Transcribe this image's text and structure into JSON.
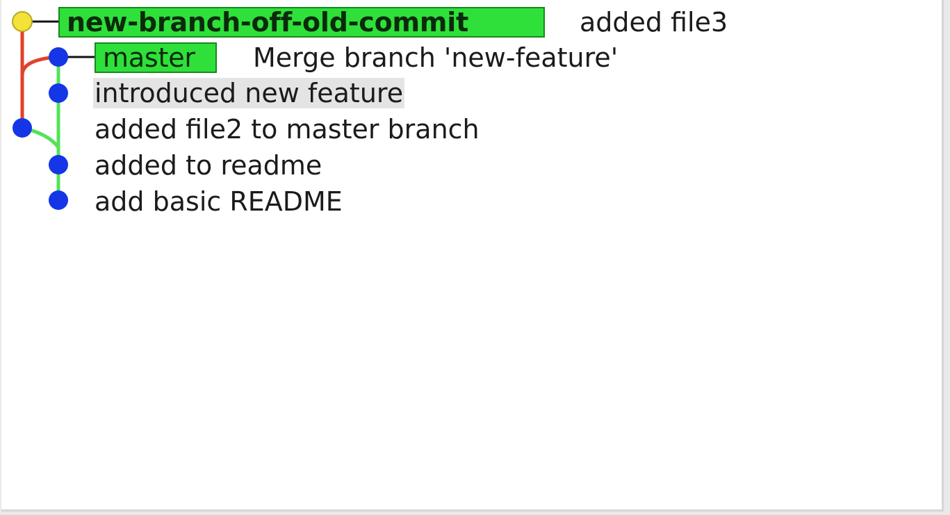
{
  "colors": {
    "ref_badge": "#2fe03a",
    "commit_blue": "#1536e6",
    "head_yellow": "#f2e23a",
    "branch_red": "#e0422a",
    "branch_green": "#53e25a",
    "selected_row": "#e4e4e4"
  },
  "commits": [
    {
      "ref": "new-branch-off-old-commit",
      "message": "added file3"
    },
    {
      "ref": "master",
      "message": "Merge branch 'new-feature'"
    },
    {
      "message": "introduced new feature"
    },
    {
      "message": "added file2 to master branch"
    },
    {
      "message": "added to readme"
    },
    {
      "message": "add basic README"
    }
  ]
}
